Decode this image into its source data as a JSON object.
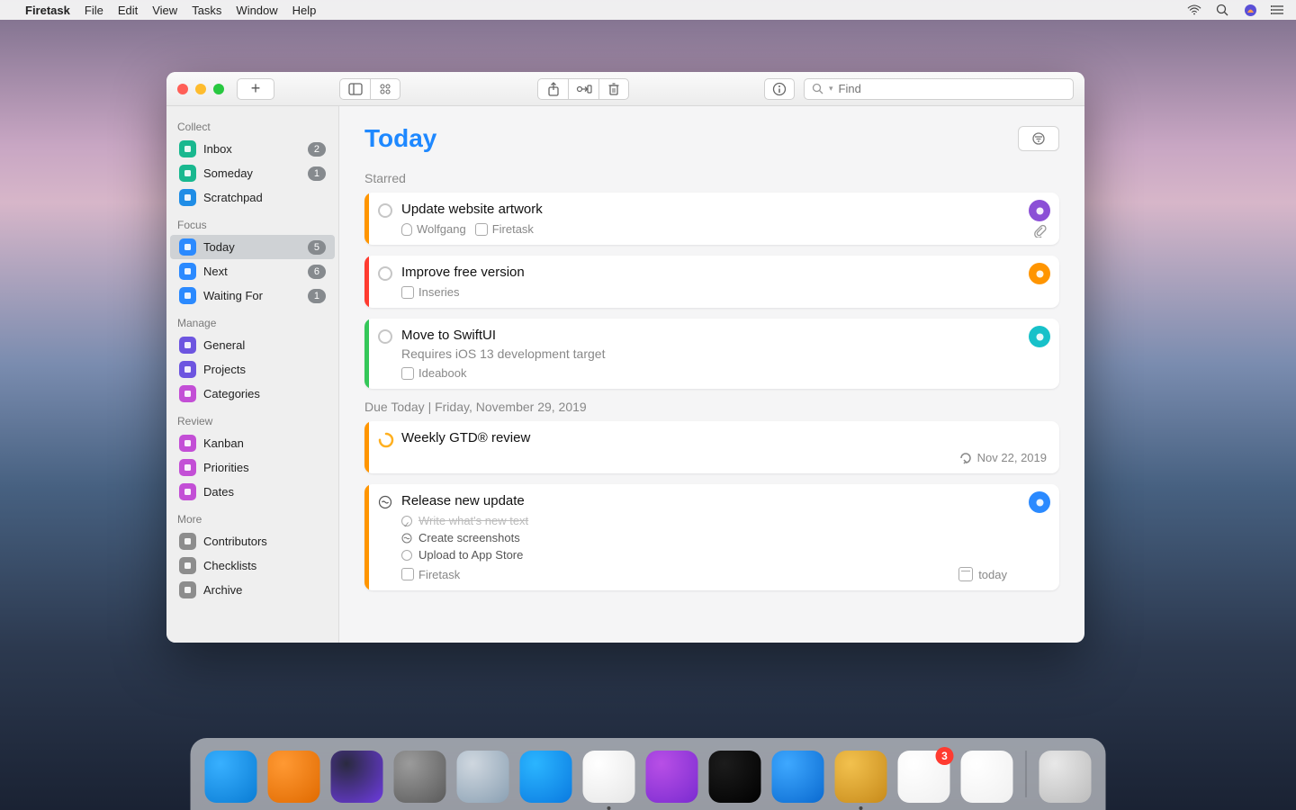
{
  "menubar": {
    "app": "Firetask",
    "items": [
      "File",
      "Edit",
      "View",
      "Tasks",
      "Window",
      "Help"
    ]
  },
  "toolbar": {
    "search_placeholder": "Find"
  },
  "sidebar": {
    "sections": [
      {
        "title": "Collect",
        "items": [
          {
            "icon": "#19b88f",
            "label": "Inbox",
            "badge": "2"
          },
          {
            "icon": "#19b88f",
            "label": "Someday",
            "badge": "1"
          },
          {
            "icon": "#1f8de6",
            "label": "Scratchpad"
          }
        ]
      },
      {
        "title": "Focus",
        "items": [
          {
            "icon": "#2b8aff",
            "label": "Today",
            "badge": "5",
            "selected": true
          },
          {
            "icon": "#2b8aff",
            "label": "Next",
            "badge": "6"
          },
          {
            "icon": "#2b8aff",
            "label": "Waiting For",
            "badge": "1"
          }
        ]
      },
      {
        "title": "Manage",
        "items": [
          {
            "icon": "#6d55e0",
            "label": "General"
          },
          {
            "icon": "#6d55e0",
            "label": "Projects"
          },
          {
            "icon": "#c34fd6",
            "label": "Categories"
          }
        ]
      },
      {
        "title": "Review",
        "items": [
          {
            "icon": "#c34fd6",
            "label": "Kanban"
          },
          {
            "icon": "#c34fd6",
            "label": "Priorities"
          },
          {
            "icon": "#c34fd6",
            "label": "Dates"
          }
        ]
      },
      {
        "title": "More",
        "items": [
          {
            "icon": "#8d8d8d",
            "label": "Contributors"
          },
          {
            "icon": "#8d8d8d",
            "label": "Checklists"
          },
          {
            "icon": "#8d8d8d",
            "label": "Archive"
          }
        ]
      }
    ]
  },
  "page": {
    "title": "Today",
    "starred_label": "Starred",
    "due_label": "Due Today  |  Friday, November 29, 2019",
    "starred": [
      {
        "stripe": "#ff9500",
        "title": "Update website artwork",
        "assignee": "Wolfgang",
        "project": "Firetask",
        "badge": "#8b4fd6",
        "attach": true
      },
      {
        "stripe": "#ff3b30",
        "title": "Improve free version",
        "project": "Inseries",
        "badge": "#ff9500"
      },
      {
        "stripe": "#34c759",
        "title": "Move to SwiftUI",
        "note": "Requires iOS 13 development target",
        "project": "Ideabook",
        "badge": "#17c1c9"
      }
    ],
    "due": [
      {
        "stripe": "#ff9500",
        "title": "Weekly GTD® review",
        "check": "progress",
        "repeat": "Nov 22, 2019"
      },
      {
        "stripe": "#ff9500",
        "title": "Release new update",
        "check": "wave",
        "project": "Firetask",
        "badge": "#2b8aff",
        "date_label": "today",
        "subtasks": [
          {
            "done": true,
            "t": "Write what's new text"
          },
          {
            "wave": true,
            "t": "Create screenshots"
          },
          {
            "t": "Upload to App Store"
          }
        ]
      }
    ]
  },
  "dock": {
    "apps": [
      {
        "name": "finder",
        "c1": "#38b0ff",
        "c2": "#0a7cd4"
      },
      {
        "name": "home",
        "c1": "#ff9933",
        "c2": "#e06a00"
      },
      {
        "name": "siri",
        "c1": "#2a2a40",
        "c2": "#6d3be0"
      },
      {
        "name": "settings",
        "c1": "#9b9b9b",
        "c2": "#5a5a5a"
      },
      {
        "name": "launchpad",
        "c1": "#cfd7df",
        "c2": "#8aa0b3"
      },
      {
        "name": "appstore",
        "c1": "#2bb5ff",
        "c2": "#0a7ae0"
      },
      {
        "name": "music",
        "c1": "#ffffff",
        "c2": "#e6e6e6",
        "dot": true
      },
      {
        "name": "podcasts",
        "c1": "#b84fe6",
        "c2": "#7a2bd0"
      },
      {
        "name": "tv",
        "c1": "#1c1c1c",
        "c2": "#000000"
      },
      {
        "name": "safari",
        "c1": "#3ea8ff",
        "c2": "#0a6ad0"
      },
      {
        "name": "mail",
        "c1": "#f2c14e",
        "c2": "#c78a1a",
        "dot": true
      },
      {
        "name": "firetask",
        "c1": "#ffffff",
        "c2": "#f0f0f0",
        "notif": "3"
      },
      {
        "name": "photos",
        "c1": "#ffffff",
        "c2": "#f0f0f0"
      }
    ],
    "trash": "trash"
  }
}
